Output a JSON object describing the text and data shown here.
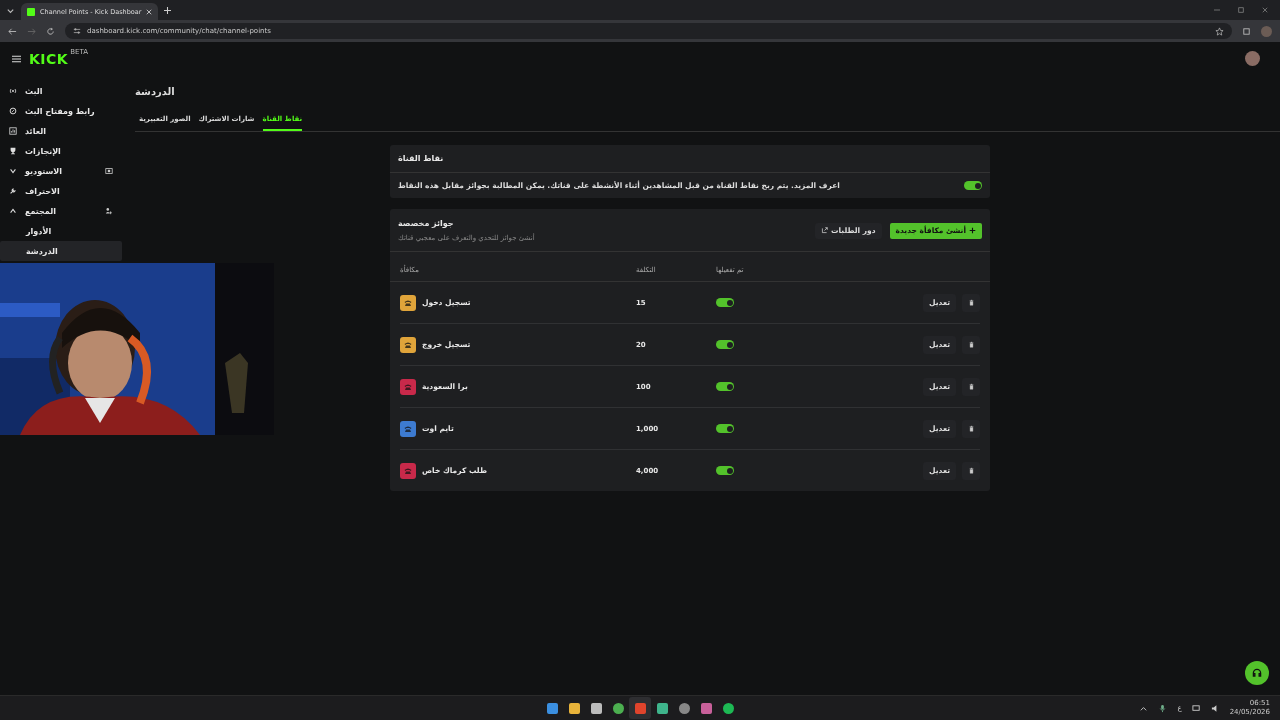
{
  "browser": {
    "tab_title": "Channel Points - Kick Dashboar",
    "url": "dashboard.kick.com/community/chat/channel-points"
  },
  "app": {
    "logo": "KICK",
    "logo_badge": "BETA"
  },
  "sidebar": {
    "items": [
      {
        "label": "البث",
        "kind": "link",
        "selected": false
      },
      {
        "label": "رابط ومفتاح البث",
        "kind": "link",
        "selected": false
      },
      {
        "label": "العائد",
        "kind": "link",
        "selected": false
      },
      {
        "label": "الإنجازات",
        "kind": "link",
        "selected": false
      },
      {
        "label": "الاستوديو",
        "kind": "group",
        "expanded": false,
        "selected": false
      },
      {
        "label": "الاحتراف",
        "kind": "link",
        "selected": false
      },
      {
        "label": "المجتمع",
        "kind": "group",
        "expanded": true,
        "selected": false,
        "children": [
          {
            "label": "الأدوار",
            "selected": false
          },
          {
            "label": "الدردشة",
            "selected": true
          }
        ]
      }
    ]
  },
  "page": {
    "title": "الدردشة",
    "tabs": [
      {
        "label": "نقاط القناة",
        "selected": true
      },
      {
        "label": "شارات الاشتراك",
        "selected": false
      },
      {
        "label": "الصور التعبيرية",
        "selected": false
      }
    ]
  },
  "channel_points": {
    "title": "نقاط القناة",
    "link": "اعرف المزيد",
    "description": ". يتم ربح نقاط القناة من قبل المشاهدين أثناء الأنشطة على قناتك. يمكن المطالبة بجوائز مقابل هذه النقاط",
    "on": true
  },
  "rewards": {
    "title": "جوائز مخصصة",
    "subtitle": "أنشئ جوائز للتحدي والتعرف على معجبي قناتك",
    "create_button": "أنشئ مكافأة جديدة",
    "queue_button": "دور الطلبات",
    "columns": [
      "تم تفعيلها",
      "التكلفة",
      "مكافأة"
    ],
    "rows": [
      {
        "name": "تسجيل دخول",
        "color": "#e0a43a",
        "cost": "15",
        "on": true,
        "edit": "تعديل"
      },
      {
        "name": "تسجيل خروج",
        "color": "#e0a43a",
        "cost": "20",
        "on": true,
        "edit": "تعديل"
      },
      {
        "name": "برا السعودية",
        "color": "#c8294a",
        "cost": "100",
        "on": true,
        "edit": "تعديل"
      },
      {
        "name": "تايم اوت",
        "color": "#3d7bd0",
        "cost": "1,000",
        "on": true,
        "edit": "تعديل"
      },
      {
        "name": "طلب كرماك خاص",
        "color": "#c8294a",
        "cost": "4,000",
        "on": true,
        "edit": "تعديل"
      }
    ]
  },
  "taskbar": {
    "language": "ع",
    "time": "06:51",
    "date": "24/05/2026"
  }
}
